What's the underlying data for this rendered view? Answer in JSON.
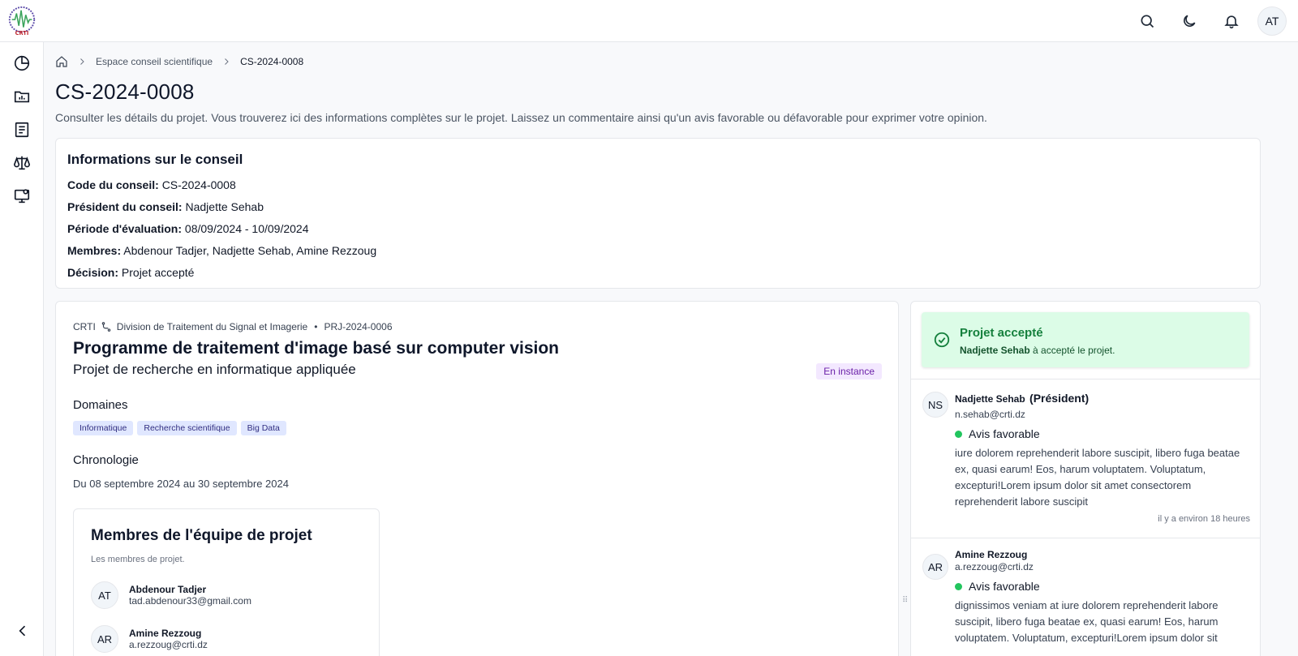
{
  "topbar": {
    "avatar_initials": "AT",
    "icons": [
      "search-icon",
      "moon-icon",
      "bell-icon"
    ]
  },
  "sidebar": {
    "icons": [
      "pie-chart-icon",
      "folder-chart-icon",
      "list-icon",
      "scale-icon",
      "monitor-user-icon"
    ],
    "collapse_icon": "chevron-left-icon"
  },
  "breadcrumb": {
    "home_icon": "home-icon",
    "items": [
      "Espace conseil scientifique",
      "CS-2024-0008"
    ]
  },
  "page": {
    "title": "CS-2024-0008",
    "description": "Consulter les détails du projet. Vous trouverez ici des informations complètes sur le projet. Laissez un commentaire ainsi qu'un avis favorable ou défavorable pour exprimer votre opinion."
  },
  "info_card": {
    "title": "Informations sur le conseil",
    "rows": [
      {
        "label": "Code du conseil:",
        "value": "CS-2024-0008"
      },
      {
        "label": "Président du conseil:",
        "value": "Nadjette Sehab"
      },
      {
        "label": "Période d'évaluation:",
        "value": "08/09/2024 - 10/09/2024"
      },
      {
        "label": "Membres:",
        "value": "Abdenour Tadjer, Nadjette Sehab, Amine Rezzoug"
      },
      {
        "label": "Décision:",
        "value": "Projet accepté"
      }
    ]
  },
  "project": {
    "org": "CRTI",
    "division": "Division de Traitement du Signal et Imagerie",
    "bullet": "•",
    "code": "PRJ-2024-0006",
    "title": "Programme de traitement d'image basé sur computer vision",
    "subtitle": "Projet de recherche en informatique appliquée",
    "status": "En instance",
    "domains_title": "Domaines",
    "domains": [
      "Informatique",
      "Recherche scientifique",
      "Big Data"
    ],
    "chronology_title": "Chronologie",
    "chronology": "Du 08 septembre 2024 au 30 septembre 2024"
  },
  "team": {
    "title": "Membres de l'équipe de projet",
    "description": "Les membres de projet.",
    "members": [
      {
        "initials": "AT",
        "name": "Abdenour Tadjer",
        "email": "tad.abdenour33@gmail.com"
      },
      {
        "initials": "AR",
        "name": "Amine Rezzoug",
        "email": "a.rezzoug@crti.dz"
      }
    ]
  },
  "decision": {
    "title": "Projet accepté",
    "by": "Nadjette Sehab",
    "text": "à accepté le projet."
  },
  "avis": [
    {
      "initials": "NS",
      "name": "Nadjette Sehab",
      "role": "(Président)",
      "email": "n.sehab@crti.dz",
      "verdict": "Avis favorable",
      "comment": "iure dolorem reprehenderit labore suscipit, libero fuga beatae ex, quasi earum! Eos, harum voluptatem. Voluptatum, excepturi!Lorem ipsum dolor sit amet consectorem reprehenderit labore suscipit",
      "time": "il y a environ 18 heures"
    },
    {
      "initials": "AR",
      "name": "Amine Rezzoug",
      "role": "",
      "email": "a.rezzoug@crti.dz",
      "verdict": "Avis favorable",
      "comment": "dignissimos veniam at iure dolorem reprehenderit labore suscipit, libero fuga beatae ex, quasi earum! Eos, harum voluptatem. Voluptatum, excepturi!Lorem ipsum dolor sit",
      "time": ""
    }
  ],
  "colors": {
    "accent_green": "#15803d",
    "accepted_bg": "#dcfce7",
    "status_bg": "#f3e8ff",
    "tag_bg": "#e0e7ff",
    "favorable_dot": "#22c55e"
  }
}
